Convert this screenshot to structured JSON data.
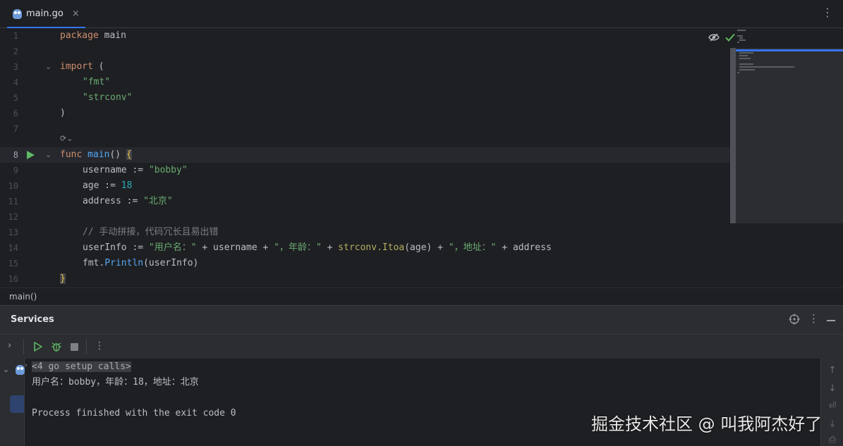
{
  "tab": {
    "label": "main.go",
    "close": "×",
    "more": "⋮",
    "icon": "gopher-icon"
  },
  "editor": {
    "lines": [
      {
        "n": "1"
      },
      {
        "n": "2"
      },
      {
        "n": "3"
      },
      {
        "n": "4"
      },
      {
        "n": "5"
      },
      {
        "n": "6"
      },
      {
        "n": "7"
      },
      {
        "n": "8"
      },
      {
        "n": "9"
      },
      {
        "n": "10"
      },
      {
        "n": "11"
      },
      {
        "n": "12"
      },
      {
        "n": "13"
      },
      {
        "n": "14"
      },
      {
        "n": "15"
      },
      {
        "n": "16"
      }
    ],
    "code": {
      "l1_kw": "package",
      "l1_rest": " main",
      "l3_kw": "import",
      "l3_rest": " (",
      "l4": "\"fmt\"",
      "l5": "\"strconv\"",
      "l6": ")",
      "l8_kw": "func",
      "l8_fn": "main",
      "l8_rest": "() ",
      "l8_brace": "{",
      "l9_a": "username := ",
      "l9_str": "\"bobby\"",
      "l10_a": "age := ",
      "l10_num": "18",
      "l11_a": "address := ",
      "l11_str": "\"北京\"",
      "l13": "// 手动拼接，代码冗长且易出错",
      "l14_a": "userInfo := ",
      "l14_s1": "\"用户名：\"",
      "l14_b": " + username + ",
      "l14_s2": "\"，年龄：\"",
      "l14_c": " + ",
      "l14_fn": "strconv.Itoa",
      "l14_d": "(age) + ",
      "l14_s3": "\"，地址：\"",
      "l14_e": " + address",
      "l15_pkg": "fmt.",
      "l15_fn": "Println",
      "l15_rest": "(userInfo)",
      "l16": "}"
    },
    "inlay_hint": "⟳⌄",
    "fold_open": "⌄",
    "current_line": 8
  },
  "breadcrumb": {
    "label": "main()"
  },
  "services": {
    "title": "Services",
    "toolbar_more": "⋮",
    "expand": "›",
    "console": {
      "setup_calls": "<4 go setup calls>",
      "output": "用户名：bobby，年龄：18，地址：北京",
      "finished": "Process finished with the exit code 0"
    },
    "side_icons": [
      "arrow-up-icon",
      "arrow-down-icon",
      "soft-wrap-icon",
      "scroll-to-end-icon",
      "print-icon"
    ]
  },
  "watermark": "掘金技术社区 @ 叫我阿杰好了",
  "colors": {
    "accent": "#3574f0",
    "run_green": "#5fb865",
    "keyword": "#cf8e6d",
    "string": "#6aab73",
    "function": "#56a8f5",
    "number": "#2aacb8"
  }
}
